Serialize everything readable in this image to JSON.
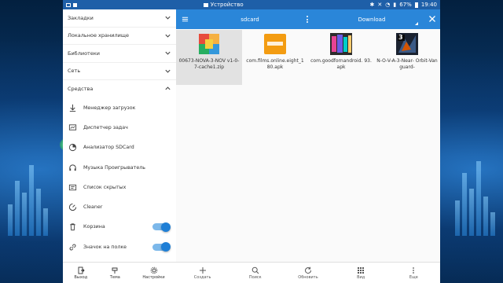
{
  "status_bar": {
    "center_label": "Устройство",
    "battery": "67%",
    "time": "19:40"
  },
  "drawer": {
    "sections": [
      {
        "label": "Закладки"
      },
      {
        "label": "Локальное хранилище"
      },
      {
        "label": "Библиотеки"
      },
      {
        "label": "Сеть"
      }
    ],
    "tools_header": "Средства",
    "tools": [
      {
        "label": "Менеджер загрузок",
        "icon": "download-icon"
      },
      {
        "label": "Диспетчер задач",
        "icon": "task-manager-icon"
      },
      {
        "label": "Анализатор SDCard",
        "icon": "sd-analyzer-icon"
      },
      {
        "label": "Музыка Проигрыватель",
        "icon": "headphones-icon"
      },
      {
        "label": "Список скрытых",
        "icon": "hidden-list-icon"
      },
      {
        "label": "Cleaner",
        "icon": "cleaner-icon"
      },
      {
        "label": "Корзина",
        "icon": "trash-icon",
        "toggle": true
      },
      {
        "label": "Значок на полке",
        "icon": "link-icon",
        "toggle": true
      }
    ],
    "bottom": [
      {
        "label": "Выход",
        "icon": "exit-icon"
      },
      {
        "label": "Тема",
        "icon": "theme-icon"
      },
      {
        "label": "Настройки",
        "icon": "settings-icon"
      }
    ]
  },
  "toolbar": {
    "crumb_1": "sdcard",
    "crumb_2": "Download"
  },
  "files": [
    {
      "name": "00673-NOVA-3-NOV v1-0-7-cache1.zip",
      "icon": "zip-archive-icon",
      "selected": true
    },
    {
      "name": "com.films.online.eight_1 80.apk",
      "icon": "films-app-icon",
      "selected": false
    },
    {
      "name": "com.goodfornandroid. 93.apk",
      "icon": "goodfornandroid-app-icon",
      "selected": false
    },
    {
      "name": "N-O-V-A-3-Near- Orbit-Vanguard-",
      "icon": "nova3-game-icon",
      "selected": false
    }
  ],
  "bottom_bar": [
    {
      "label": "Создать",
      "icon": "plus-icon"
    },
    {
      "label": "Поиск",
      "icon": "search-icon"
    },
    {
      "label": "Обновить",
      "icon": "refresh-icon"
    },
    {
      "label": "Вид",
      "icon": "grid-view-icon"
    },
    {
      "label": "Еще",
      "icon": "more-icon"
    }
  ],
  "colors": {
    "accent": "#2a86d9",
    "status_bar": "#1e5fa8",
    "toggle_on": "#1f7fd6"
  }
}
